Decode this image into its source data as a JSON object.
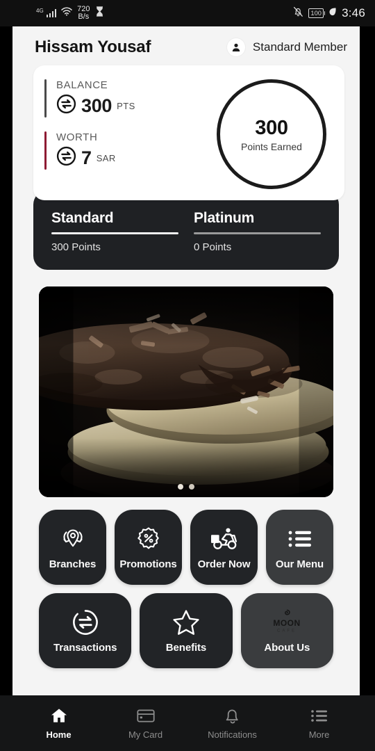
{
  "status_bar": {
    "network_type": "4G",
    "network_speed_value": "720",
    "network_speed_unit": "B/s",
    "signal_icon": "signal-bars-icon",
    "wifi_icon": "wifi-icon",
    "hourglass_icon": "hourglass-icon",
    "silent_icon": "bell-muted-icon",
    "battery_level": "100",
    "battery_saver_icon": "leaf-icon",
    "clock": "3:46"
  },
  "header": {
    "user_name": "Hissam Yousaf",
    "member_icon": "person-icon",
    "member_label": "Standard Member"
  },
  "balance_card": {
    "rows": [
      {
        "label": "BALANCE",
        "value": "300",
        "unit": "PTS",
        "icon": "exchange-circle-icon",
        "accent_color": "#4a4a4a"
      },
      {
        "label": "WORTH",
        "value": "7",
        "unit": "SAR",
        "icon": "exchange-circle-icon",
        "accent_color": "#8e1b33"
      }
    ],
    "ring": {
      "value": "300",
      "label": "Points Earned"
    }
  },
  "tier_card": {
    "tiers": [
      {
        "name": "Standard",
        "points": "300 Points",
        "state": "active"
      },
      {
        "name": "Platinum",
        "points": "0 Points",
        "state": "inactive"
      }
    ]
  },
  "banner": {
    "alt": "Stacked chocolate and vanilla cookies photograph",
    "slide_count": 2,
    "active_slide": 1
  },
  "actions": {
    "row1": [
      {
        "label": "Branches",
        "icon": "location-pin-icon",
        "shade": "dark"
      },
      {
        "label": "Promotions",
        "icon": "discount-badge-icon",
        "shade": "dark"
      },
      {
        "label": "Order Now",
        "icon": "delivery-scooter-icon",
        "shade": "dark"
      },
      {
        "label": "Our Menu",
        "icon": "list-bullets-icon",
        "shade": "light"
      }
    ],
    "row2": [
      {
        "label": "Transactions",
        "icon": "exchange-circle-icon",
        "shade": "dark"
      },
      {
        "label": "Benefits",
        "icon": "star-outline-icon",
        "shade": "dark"
      },
      {
        "label": "About Us",
        "icon": "moon-cafe-logo-icon",
        "shade": "light"
      }
    ]
  },
  "bottom_nav": {
    "items": [
      {
        "label": "Home",
        "icon": "home-icon",
        "state": "active"
      },
      {
        "label": "My Card",
        "icon": "card-icon",
        "state": "inactive"
      },
      {
        "label": "Notifications",
        "icon": "bell-icon",
        "state": "inactive"
      },
      {
        "label": "More",
        "icon": "list-bullets-icon",
        "state": "inactive"
      }
    ]
  },
  "theme": {
    "page_background": "#f4f4f4",
    "card_dark": "#222427",
    "card_dark_light": "#3a3c3e",
    "accent_maroon": "#8e1b33",
    "nav_background": "#151617"
  }
}
